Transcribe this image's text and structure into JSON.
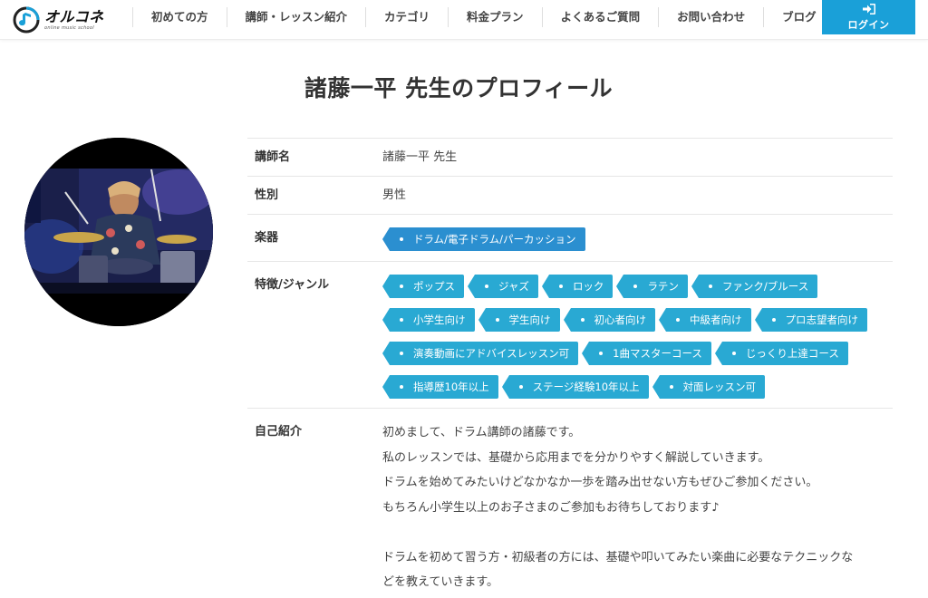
{
  "header": {
    "logo_name": "オルコネ",
    "logo_sub": "online music school",
    "nav": [
      {
        "label": "初めての方"
      },
      {
        "label": "講師・レッスン紹介"
      },
      {
        "label": "カテゴリ"
      },
      {
        "label": "料金プラン"
      },
      {
        "label": "よくあるご質問"
      },
      {
        "label": "お問い合わせ"
      },
      {
        "label": "ブログ"
      }
    ],
    "login_label": "ログイン"
  },
  "page_title": "諸藤一平 先生のプロフィール",
  "profile": {
    "name_label": "講師名",
    "name_value": "諸藤一平 先生",
    "gender_label": "性別",
    "gender_value": "男性",
    "instrument_label": "楽器",
    "instruments": [
      "ドラム/電子ドラム/パーカッション"
    ],
    "genre_label": "特徴/ジャンル",
    "genres": [
      "ポップス",
      "ジャズ",
      "ロック",
      "ラテン",
      "ファンク/ブルース",
      "小学生向け",
      "学生向け",
      "初心者向け",
      "中級者向け",
      "プロ志望者向け",
      "演奏動画にアドバイスレッスン可",
      "1曲マスターコース",
      "じっくり上達コース",
      "指導歴10年以上",
      "ステージ経験10年以上",
      "対面レッスン可"
    ],
    "intro_label": "自己紹介",
    "intro_lines": [
      "初めまして、ドラム講師の諸藤です。",
      "私のレッスンでは、基礎から応用までを分かりやすく解説していきます。",
      "ドラムを始めてみたいけどなかなか一歩を踏み出せない方もぜひご参加ください。",
      "もちろん小学生以上のお子さまのご参加もお待ちしております♪",
      "",
      "ドラムを初めて習う方・初級者の方には、基礎や叩いてみたい楽曲に必要なテクニックな",
      "どを教えていきます。"
    ]
  },
  "colors": {
    "accent": "#1aa0d8",
    "tag": "#29a9d3",
    "instrument_tag": "#2b8fd0"
  }
}
